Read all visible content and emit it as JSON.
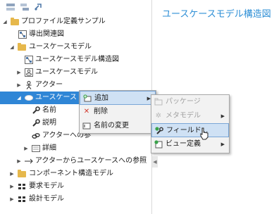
{
  "toolbar": {
    "icons": [
      "collapse-all-icon",
      "expand-all-icon",
      "link-icon"
    ]
  },
  "tree": [
    {
      "name": "profile-sample",
      "label": "プロファイル定義サンプル",
      "icon": "folder-icon",
      "expander": "expanded"
    },
    {
      "name": "derivation-diagram",
      "label": "導出関連図",
      "icon": "diagram-icon",
      "expander": ""
    },
    {
      "name": "usecase-model",
      "label": "ユースケースモデル",
      "icon": "folder-icon",
      "expander": "expanded"
    },
    {
      "name": "usecase-structure-diagram",
      "label": "ユースケースモデル構造図",
      "icon": "diagram-icon",
      "expander": ""
    },
    {
      "name": "usecase-model-element",
      "label": "ユースケースモデル",
      "icon": "model-icon",
      "expander": "collapsed"
    },
    {
      "name": "actor",
      "label": "アクター",
      "icon": "actor-icon",
      "expander": "collapsed"
    },
    {
      "name": "usecase",
      "label": "ユースケース",
      "icon": "usecase-icon",
      "expander": "expanded"
    },
    {
      "name": "field-name",
      "label": "名前",
      "icon": "wrench-icon",
      "expander": ""
    },
    {
      "name": "field-description",
      "label": "説明",
      "icon": "wrench-icon",
      "expander": ""
    },
    {
      "name": "ref-to-actor",
      "label": "アクターへの参",
      "icon": "link-icon",
      "expander": ""
    },
    {
      "name": "details",
      "label": "詳細",
      "icon": "box-icon",
      "expander": "collapsed"
    },
    {
      "name": "actor-to-usecase-ref",
      "label": "アクターからユースケースへの参照",
      "icon": "arrow-icon",
      "expander": "collapsed"
    },
    {
      "name": "component-structure-model",
      "label": "コンポーネント構造モデル",
      "icon": "folder-icon",
      "expander": "collapsed"
    },
    {
      "name": "requirement-model",
      "label": "要求モデル",
      "icon": "grid-icon",
      "expander": "collapsed"
    },
    {
      "name": "design-model",
      "label": "設計モデル",
      "icon": "grid-icon",
      "expander": "collapsed"
    }
  ],
  "right_panel": {
    "title": "ユースケースモデル構造図"
  },
  "context_menu": {
    "items": [
      {
        "label": "追加",
        "icon": "add-icon",
        "submenu": true
      },
      {
        "label": "削除",
        "icon": "delete-icon",
        "submenu": false
      },
      {
        "label": "名前の変更",
        "icon": "rename-icon",
        "submenu": false
      }
    ]
  },
  "submenu": {
    "items": [
      {
        "label": "パッケージ",
        "icon": "package-icon",
        "submenu": false,
        "disabled": true
      },
      {
        "label": "メタモデル",
        "icon": "metamodel-icon",
        "submenu": true,
        "disabled": true
      },
      {
        "label": "フィールド...",
        "icon": "field-add-icon",
        "submenu": false,
        "disabled": false
      },
      {
        "label": "ビュー定義",
        "icon": "view-definition-icon",
        "submenu": true,
        "disabled": false
      }
    ]
  },
  "colors": {
    "accent": "#2e8fd6",
    "selection": "#2f86d6",
    "folder": "#e6b84c",
    "highlight": "#cfe1f4"
  }
}
